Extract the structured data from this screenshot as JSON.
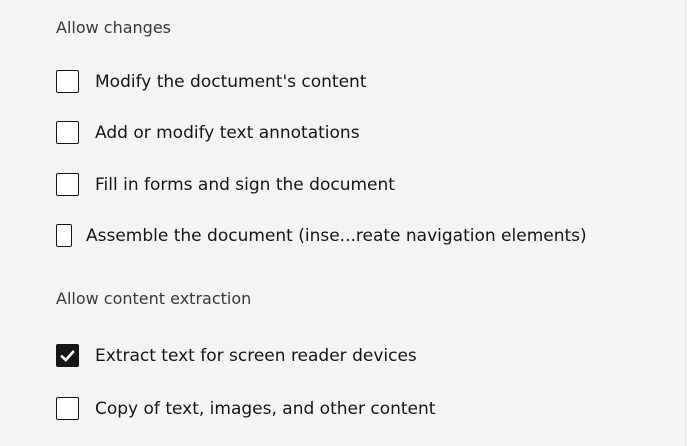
{
  "sections": [
    {
      "title": "Allow changes",
      "options": [
        {
          "label": "Modify the doctument's content",
          "checked": false
        },
        {
          "label": "Add or modify text annotations",
          "checked": false
        },
        {
          "label": "Fill in forms and sign the document",
          "checked": false
        },
        {
          "label": "Assemble the document (inse...reate navigation elements)",
          "checked": false
        }
      ]
    },
    {
      "title": "Allow content extraction",
      "options": [
        {
          "label": "Extract text for screen reader devices",
          "checked": true
        },
        {
          "label": "Copy of text, images, and other content",
          "checked": false
        }
      ]
    }
  ],
  "icons": {
    "checked": "checkmark-icon"
  },
  "colors": {
    "panel_background": "#f4f4f4",
    "checkbox_border": "#161616",
    "checkbox_checked_fill": "#161616",
    "checkmark": "#ffffff",
    "text": "#161616"
  }
}
